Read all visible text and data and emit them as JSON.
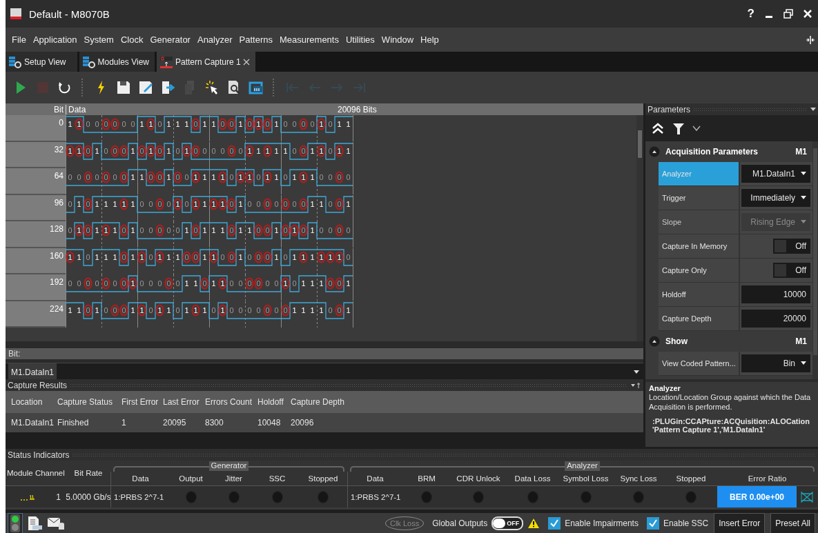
{
  "window": {
    "title": "Default - M8070B",
    "help": "?"
  },
  "menu": [
    "File",
    "Application",
    "System",
    "Clock",
    "Generator",
    "Analyzer",
    "Patterns",
    "Measurements",
    "Utilities",
    "Window",
    "Help"
  ],
  "tabs": [
    {
      "label": "Setup View",
      "selected": false,
      "closable": false
    },
    {
      "label": "Modules View",
      "selected": false,
      "closable": false
    },
    {
      "label": "Pattern Capture 1",
      "selected": true,
      "closable": true
    }
  ],
  "toolbar": [
    {
      "kind": "play",
      "disabled": false
    },
    {
      "kind": "stop",
      "disabled": true
    },
    {
      "kind": "reset",
      "disabled": false
    },
    {
      "kind": "separator"
    },
    {
      "kind": "flash",
      "disabled": false
    },
    {
      "kind": "save",
      "disabled": false
    },
    {
      "kind": "save-edit",
      "disabled": false
    },
    {
      "kind": "export",
      "disabled": false
    },
    {
      "kind": "copy",
      "disabled": true
    },
    {
      "kind": "pointer",
      "disabled": false
    },
    {
      "kind": "inspect",
      "disabled": false
    },
    {
      "kind": "loop",
      "disabled": false
    },
    {
      "kind": "separator"
    },
    {
      "kind": "first",
      "disabled": true
    },
    {
      "kind": "prev",
      "disabled": true
    },
    {
      "kind": "next",
      "disabled": true
    },
    {
      "kind": "last",
      "disabled": true
    }
  ],
  "pattern": {
    "index_label": "Bit",
    "data_label": "Data",
    "total": "20096 Bits",
    "rows": [
      {
        "index": "0",
        "bits": [
          {
            "bit": "1",
            "error": false
          },
          {
            "bit": "1",
            "error": true
          },
          {
            "bit": "0",
            "error": false
          },
          {
            "bit": "0",
            "error": false
          },
          {
            "bit": "0",
            "error": true
          },
          {
            "bit": "0",
            "error": true
          },
          {
            "bit": "0",
            "error": false
          },
          {
            "bit": "0",
            "error": false
          },
          {
            "bit": "1",
            "error": false
          },
          {
            "bit": "1",
            "error": true
          },
          {
            "bit": "0",
            "error": false
          },
          {
            "bit": "1",
            "error": false
          },
          {
            "bit": "1",
            "error": false
          },
          {
            "bit": "1",
            "error": false
          },
          {
            "bit": "0",
            "error": true
          },
          {
            "bit": "1",
            "error": false
          },
          {
            "bit": "1",
            "error": false
          },
          {
            "bit": "0",
            "error": true
          },
          {
            "bit": "0",
            "error": true
          },
          {
            "bit": "1",
            "error": false
          },
          {
            "bit": "0",
            "error": true
          },
          {
            "bit": "1",
            "error": true
          },
          {
            "bit": "0",
            "error": true
          },
          {
            "bit": "1",
            "error": false
          },
          {
            "bit": "0",
            "error": false
          },
          {
            "bit": "0",
            "error": false
          },
          {
            "bit": "0",
            "error": true
          },
          {
            "bit": "0",
            "error": false
          },
          {
            "bit": "1",
            "error": true
          },
          {
            "bit": "0",
            "error": false
          },
          {
            "bit": "1",
            "error": false
          },
          {
            "bit": "1",
            "error": false
          }
        ]
      },
      {
        "index": "32",
        "bits": [
          {
            "bit": "1",
            "error": true
          },
          {
            "bit": "1",
            "error": true
          },
          {
            "bit": "0",
            "error": true
          },
          {
            "bit": "1",
            "error": false
          },
          {
            "bit": "0",
            "error": false
          },
          {
            "bit": "0",
            "error": true
          },
          {
            "bit": "0",
            "error": true
          },
          {
            "bit": "1",
            "error": false
          },
          {
            "bit": "0",
            "error": true
          },
          {
            "bit": "1",
            "error": true
          },
          {
            "bit": "0",
            "error": true
          },
          {
            "bit": "1",
            "error": false
          },
          {
            "bit": "0",
            "error": false
          },
          {
            "bit": "1",
            "error": true
          },
          {
            "bit": "0",
            "error": true
          },
          {
            "bit": "0",
            "error": false
          },
          {
            "bit": "0",
            "error": false
          },
          {
            "bit": "0",
            "error": false
          },
          {
            "bit": "0",
            "error": true
          },
          {
            "bit": "0",
            "error": false
          },
          {
            "bit": "1",
            "error": true
          },
          {
            "bit": "1",
            "error": false
          },
          {
            "bit": "1",
            "error": true
          },
          {
            "bit": "1",
            "error": false
          },
          {
            "bit": "1",
            "error": false
          },
          {
            "bit": "0",
            "error": false
          },
          {
            "bit": "0",
            "error": true
          },
          {
            "bit": "1",
            "error": false
          },
          {
            "bit": "1",
            "error": true
          },
          {
            "bit": "0",
            "error": false
          },
          {
            "bit": "1",
            "error": true
          },
          {
            "bit": "1",
            "error": false
          }
        ]
      },
      {
        "index": "64",
        "bits": [
          {
            "bit": "0",
            "error": false
          },
          {
            "bit": "0",
            "error": false
          },
          {
            "bit": "0",
            "error": true
          },
          {
            "bit": "0",
            "error": false
          },
          {
            "bit": "0",
            "error": true
          },
          {
            "bit": "0",
            "error": false
          },
          {
            "bit": "0",
            "error": true
          },
          {
            "bit": "1",
            "error": false
          },
          {
            "bit": "1",
            "error": false
          },
          {
            "bit": "0",
            "error": true
          },
          {
            "bit": "0",
            "error": true
          },
          {
            "bit": "1",
            "error": false
          },
          {
            "bit": "0",
            "error": true
          },
          {
            "bit": "0",
            "error": false
          },
          {
            "bit": "1",
            "error": true
          },
          {
            "bit": "1",
            "error": false
          },
          {
            "bit": "1",
            "error": false
          },
          {
            "bit": "1",
            "error": true
          },
          {
            "bit": "0",
            "error": false
          },
          {
            "bit": "1",
            "error": true
          },
          {
            "bit": "1",
            "error": true
          },
          {
            "bit": "0",
            "error": false
          },
          {
            "bit": "1",
            "error": true
          },
          {
            "bit": "1",
            "error": false
          },
          {
            "bit": "0",
            "error": false
          },
          {
            "bit": "1",
            "error": false
          },
          {
            "bit": "1",
            "error": true
          },
          {
            "bit": "1",
            "error": false
          },
          {
            "bit": "0",
            "error": false
          },
          {
            "bit": "0",
            "error": false
          },
          {
            "bit": "0",
            "error": true
          },
          {
            "bit": "0",
            "error": false
          }
        ]
      },
      {
        "index": "96",
        "bits": [
          {
            "bit": "0",
            "error": false
          },
          {
            "bit": "1",
            "error": false
          },
          {
            "bit": "0",
            "error": true
          },
          {
            "bit": "1",
            "error": false
          },
          {
            "bit": "1",
            "error": false
          },
          {
            "bit": "1",
            "error": false
          },
          {
            "bit": "1",
            "error": true
          },
          {
            "bit": "1",
            "error": false
          },
          {
            "bit": "0",
            "error": false
          },
          {
            "bit": "0",
            "error": false
          },
          {
            "bit": "0",
            "error": true
          },
          {
            "bit": "0",
            "error": false
          },
          {
            "bit": "1",
            "error": true
          },
          {
            "bit": "0",
            "error": false
          },
          {
            "bit": "1",
            "error": true
          },
          {
            "bit": "1",
            "error": false
          },
          {
            "bit": "1",
            "error": true
          },
          {
            "bit": "1",
            "error": true
          },
          {
            "bit": "0",
            "error": true
          },
          {
            "bit": "1",
            "error": false
          },
          {
            "bit": "0",
            "error": false
          },
          {
            "bit": "0",
            "error": false
          },
          {
            "bit": "0",
            "error": true
          },
          {
            "bit": "0",
            "error": false
          },
          {
            "bit": "0",
            "error": true
          },
          {
            "bit": "0",
            "error": false
          },
          {
            "bit": "0",
            "error": true
          },
          {
            "bit": "1",
            "error": false
          },
          {
            "bit": "1",
            "error": false
          },
          {
            "bit": "0",
            "error": false
          },
          {
            "bit": "0",
            "error": true
          },
          {
            "bit": "1",
            "error": false
          }
        ]
      },
      {
        "index": "128",
        "bits": [
          {
            "bit": "0",
            "error": false
          },
          {
            "bit": "1",
            "error": true
          },
          {
            "bit": "0",
            "error": true
          },
          {
            "bit": "1",
            "error": false
          },
          {
            "bit": "1",
            "error": true
          },
          {
            "bit": "1",
            "error": false
          },
          {
            "bit": "0",
            "error": true
          },
          {
            "bit": "1",
            "error": false
          },
          {
            "bit": "0",
            "error": false
          },
          {
            "bit": "0",
            "error": false
          },
          {
            "bit": "0",
            "error": true
          },
          {
            "bit": "0",
            "error": false
          },
          {
            "bit": "0",
            "error": false
          },
          {
            "bit": "1",
            "error": false
          },
          {
            "bit": "0",
            "error": true
          },
          {
            "bit": "1",
            "error": false
          },
          {
            "bit": "1",
            "error": false
          },
          {
            "bit": "1",
            "error": false
          },
          {
            "bit": "0",
            "error": true
          },
          {
            "bit": "1",
            "error": false
          },
          {
            "bit": "1",
            "error": false
          },
          {
            "bit": "0",
            "error": true
          },
          {
            "bit": "0",
            "error": true
          },
          {
            "bit": "1",
            "error": false
          },
          {
            "bit": "0",
            "error": true
          },
          {
            "bit": "1",
            "error": true
          },
          {
            "bit": "0",
            "error": true
          },
          {
            "bit": "1",
            "error": false
          },
          {
            "bit": "0",
            "error": false
          },
          {
            "bit": "0",
            "error": false
          },
          {
            "bit": "0",
            "error": true
          },
          {
            "bit": "0",
            "error": false
          }
        ]
      },
      {
        "index": "160",
        "bits": [
          {
            "bit": "1",
            "error": true
          },
          {
            "bit": "1",
            "error": false
          },
          {
            "bit": "0",
            "error": false
          },
          {
            "bit": "1",
            "error": false
          },
          {
            "bit": "1",
            "error": false
          },
          {
            "bit": "1",
            "error": false
          },
          {
            "bit": "0",
            "error": true
          },
          {
            "bit": "1",
            "error": false
          },
          {
            "bit": "1",
            "error": true
          },
          {
            "bit": "0",
            "error": false
          },
          {
            "bit": "1",
            "error": true
          },
          {
            "bit": "1",
            "error": false
          },
          {
            "bit": "1",
            "error": false
          },
          {
            "bit": "0",
            "error": true
          },
          {
            "bit": "0",
            "error": true
          },
          {
            "bit": "1",
            "error": false
          },
          {
            "bit": "1",
            "error": true
          },
          {
            "bit": "0",
            "error": false
          },
          {
            "bit": "0",
            "error": true
          },
          {
            "bit": "1",
            "error": false
          },
          {
            "bit": "0",
            "error": false
          },
          {
            "bit": "0",
            "error": true
          },
          {
            "bit": "0",
            "error": true
          },
          {
            "bit": "1",
            "error": false
          },
          {
            "bit": "0",
            "error": false
          },
          {
            "bit": "1",
            "error": false
          },
          {
            "bit": "1",
            "error": true
          },
          {
            "bit": "1",
            "error": false
          },
          {
            "bit": "1",
            "error": true
          },
          {
            "bit": "1",
            "error": true
          },
          {
            "bit": "1",
            "error": true
          },
          {
            "bit": "0",
            "error": false
          }
        ]
      },
      {
        "index": "192",
        "bits": [
          {
            "bit": "0",
            "error": false
          },
          {
            "bit": "0",
            "error": false
          },
          {
            "bit": "0",
            "error": true
          },
          {
            "bit": "0",
            "error": false
          },
          {
            "bit": "0",
            "error": true
          },
          {
            "bit": "0",
            "error": false
          },
          {
            "bit": "0",
            "error": true
          },
          {
            "bit": "1",
            "error": true
          },
          {
            "bit": "0",
            "error": false
          },
          {
            "bit": "0",
            "error": false
          },
          {
            "bit": "0",
            "error": false
          },
          {
            "bit": "0",
            "error": true
          },
          {
            "bit": "0",
            "error": false
          },
          {
            "bit": "1",
            "error": false
          },
          {
            "bit": "1",
            "error": false
          },
          {
            "bit": "0",
            "error": true
          },
          {
            "bit": "1",
            "error": false
          },
          {
            "bit": "1",
            "error": true
          },
          {
            "bit": "0",
            "error": false
          },
          {
            "bit": "0",
            "error": false
          },
          {
            "bit": "0",
            "error": true
          },
          {
            "bit": "0",
            "error": true
          },
          {
            "bit": "0",
            "error": false
          },
          {
            "bit": "0",
            "error": false
          },
          {
            "bit": "1",
            "error": true
          },
          {
            "bit": "0",
            "error": false
          },
          {
            "bit": "1",
            "error": false
          },
          {
            "bit": "1",
            "error": false
          },
          {
            "bit": "1",
            "error": false
          },
          {
            "bit": "0",
            "error": true
          },
          {
            "bit": "0",
            "error": true
          },
          {
            "bit": "1",
            "error": false
          }
        ]
      },
      {
        "index": "224",
        "bits": [
          {
            "bit": "1",
            "error": false
          },
          {
            "bit": "1",
            "error": false
          },
          {
            "bit": "0",
            "error": true
          },
          {
            "bit": "1",
            "error": false
          },
          {
            "bit": "0",
            "error": false
          },
          {
            "bit": "0",
            "error": true
          },
          {
            "bit": "0",
            "error": true
          },
          {
            "bit": "1",
            "error": false
          },
          {
            "bit": "1",
            "error": true
          },
          {
            "bit": "0",
            "error": false
          },
          {
            "bit": "1",
            "error": true
          },
          {
            "bit": "1",
            "error": false
          },
          {
            "bit": "0",
            "error": false
          },
          {
            "bit": "1",
            "error": false
          },
          {
            "bit": "1",
            "error": true
          },
          {
            "bit": "1",
            "error": false
          },
          {
            "bit": "0",
            "error": false
          },
          {
            "bit": "1",
            "error": true
          },
          {
            "bit": "0",
            "error": false
          },
          {
            "bit": "0",
            "error": false
          },
          {
            "bit": "0",
            "error": false
          },
          {
            "bit": "0",
            "error": false
          },
          {
            "bit": "0",
            "error": true
          },
          {
            "bit": "0",
            "error": false
          },
          {
            "bit": "0",
            "error": true
          },
          {
            "bit": "1",
            "error": false
          },
          {
            "bit": "1",
            "error": false
          },
          {
            "bit": "1",
            "error": false
          },
          {
            "bit": "1",
            "error": false
          },
          {
            "bit": "0",
            "error": false
          },
          {
            "bit": "0",
            "error": true
          },
          {
            "bit": "1",
            "error": false
          }
        ]
      }
    ],
    "bit_label": "Bit:",
    "location": "M1.DataIn1"
  },
  "capture_results": {
    "title": "Capture Results",
    "columns": [
      "Location",
      "Capture Status",
      "First Error",
      "Last Error",
      "Errors Count",
      "Holdoff",
      "Capture Depth"
    ],
    "rows": [
      [
        "M1.DataIn1",
        "Finished",
        "1",
        "20095",
        "8300",
        "10048",
        "20096"
      ]
    ]
  },
  "parameters": {
    "title": "Parameters",
    "sections": [
      {
        "title": "Acquisition Parameters",
        "module": "M1",
        "expanded": true,
        "rows": [
          {
            "kind": "dropdown",
            "label": "Analyzer",
            "value": "M1.DataIn1",
            "selected": true,
            "disabled": false
          },
          {
            "kind": "dropdown",
            "label": "Trigger",
            "value": "Immediately",
            "selected": false,
            "disabled": false
          },
          {
            "kind": "dropdown",
            "label": "Slope",
            "value": "Rising Edge",
            "selected": false,
            "disabled": true
          },
          {
            "kind": "toggle",
            "label": "Capture In Memory",
            "value": "Off",
            "on": false,
            "selected": false,
            "disabled": false
          },
          {
            "kind": "toggle",
            "label": "Capture Only",
            "value": "Off",
            "on": false,
            "selected": false,
            "disabled": false
          },
          {
            "kind": "number",
            "label": "Holdoff",
            "value": "10000",
            "selected": false,
            "disabled": false
          },
          {
            "kind": "number",
            "label": "Capture Depth",
            "value": "20000",
            "selected": false,
            "disabled": false
          }
        ]
      },
      {
        "title": "Show",
        "module": "M1",
        "expanded": true,
        "rows": [
          {
            "kind": "dropdown",
            "label": "View Coded Pattern...",
            "value": "Bin",
            "selected": false,
            "disabled": false
          }
        ]
      }
    ],
    "help": {
      "title": "Analyzer",
      "description": "Location/Location Group against which the Data Acquisition is performed.",
      "command": [
        ":PLUGin:CCAPture:ACQuisition:ALOCation",
        "'Pattern Capture 1','M1.DataIn1'"
      ]
    }
  },
  "status_indicators": {
    "title": "Status Indicators",
    "columns": [
      "Module Channel",
      "Bit Rate"
    ],
    "generator": {
      "title": "Generator",
      "columns": [
        "Data",
        "Output",
        "Jitter",
        "SSC",
        "Stopped"
      ]
    },
    "analyzer": {
      "title": "Analyzer",
      "columns": [
        "Data",
        "BRM",
        "CDR Unlock",
        "Data Loss",
        "Symbol Loss",
        "Sync Loss",
        "Stopped",
        "Error Ratio"
      ]
    },
    "rows": [
      {
        "channel": "1",
        "bit_rate": "5.0000 Gb/s",
        "generator_data": "1:PRBS 2^7-1",
        "generator_leds": [
          {
            "on": false
          },
          {
            "on": false
          },
          {
            "on": false
          },
          {
            "on": false
          }
        ],
        "analyzer_data": "1:PRBS 2^7-1",
        "analyzer_leds": [
          {
            "on": false
          },
          {
            "on": false
          },
          {
            "on": false
          },
          {
            "on": false
          },
          {
            "on": false
          },
          {
            "on": false
          }
        ],
        "error_ratio": "BER 0.00e+00"
      }
    ]
  },
  "bottom_bar": {
    "clk_loss": {
      "label": "Clk Loss",
      "on": false
    },
    "global_outputs": {
      "label": "Global Outputs",
      "value": "OFF",
      "on": false
    },
    "checkboxes": [
      {
        "label": "Enable Impairments",
        "checked": true
      },
      {
        "label": "Enable SSC",
        "checked": true
      }
    ],
    "buttons": [
      "Insert Error",
      "Preset All"
    ]
  }
}
